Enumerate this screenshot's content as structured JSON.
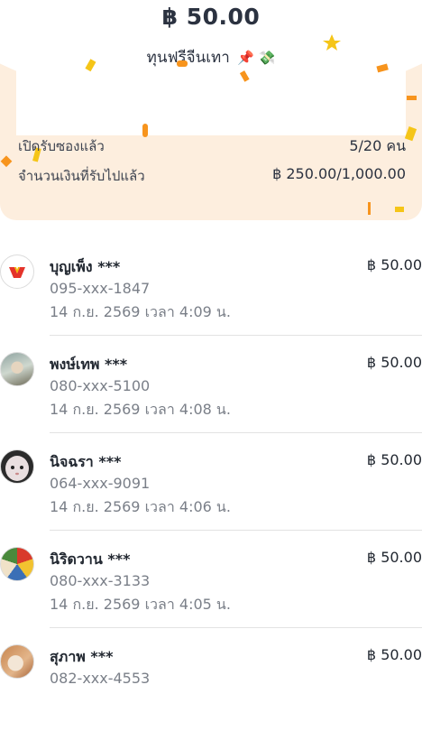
{
  "envelope": {
    "amount": "฿ 50.00",
    "message": "ทุนฟรีจีนเทา",
    "emojis": "📌 💸"
  },
  "stats": {
    "opened_label": "เปิดรับซองแล้ว",
    "opened_value": "5/20 คน",
    "claimed_label": "จำนวนเงินที่รับไปแล้ว",
    "claimed_value": "฿ 250.00/1,000.00"
  },
  "recipients": [
    {
      "name": "บุญเพ็ง ***",
      "amount": "฿ 50.00",
      "phone": "095-xxx-1847",
      "time": "14 ก.ย. 2569 เวลา 4:09 น.",
      "avatar_icon": "brand-logo-icon"
    },
    {
      "name": "พงษ์เทพ ***",
      "amount": "฿ 50.00",
      "phone": "080-xxx-5100",
      "time": "14 ก.ย. 2569 เวลา 4:08 น.",
      "avatar_icon": "person-photo-icon"
    },
    {
      "name": "นิจฉรา ***",
      "amount": "฿ 50.00",
      "phone": "064-xxx-9091",
      "time": "14 ก.ย. 2569 เวลา 4:06 น.",
      "avatar_icon": "doll-face-icon"
    },
    {
      "name": "นิริดวาน ***",
      "amount": "฿ 50.00",
      "phone": "080-xxx-3133",
      "time": "14 ก.ย. 2569 เวลา 4:05 น.",
      "avatar_icon": "cartoon-avatar-icon"
    },
    {
      "name": "สุภาพ ***",
      "amount": "฿ 50.00",
      "phone": "082-xxx-4553",
      "time": "",
      "avatar_icon": "cat-photo-icon"
    }
  ],
  "colors": {
    "panel_bg": "#fdeede",
    "confetti_orange": "#f7941d",
    "confetti_yellow": "#f5c518",
    "text_primary": "#222831",
    "text_secondary": "#7a7f88"
  }
}
